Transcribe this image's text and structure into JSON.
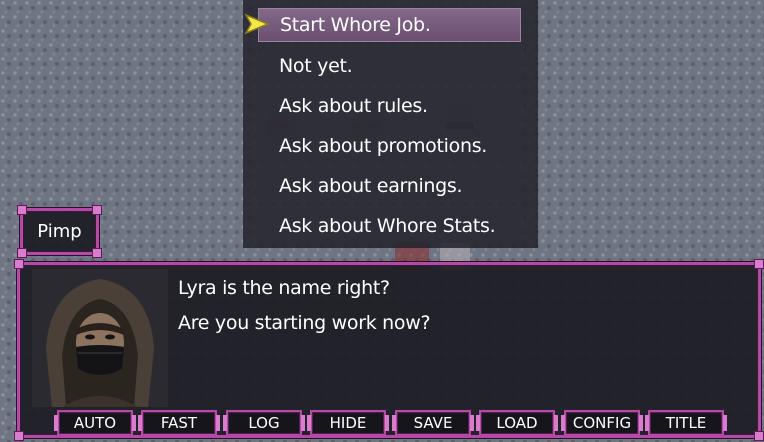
{
  "choices": [
    "Start Whore Job.",
    "Not yet.",
    "Ask about rules.",
    "Ask about promotions.",
    "Ask about earnings.",
    "Ask about Whore Stats."
  ],
  "selected_choice_index": 0,
  "speaker": "Pimp",
  "message": {
    "line1": "Lyra is the name right?",
    "line2": "Are you starting work now?"
  },
  "system_buttons": [
    "AUTO",
    "FAST",
    "LOG",
    "HIDE",
    "SAVE",
    "LOAD",
    "CONFIG",
    "TITLE"
  ],
  "colors": {
    "window_border": "#b44aa6",
    "selected_choice": "#7a5e80",
    "cursor_arrow": "#f2e64a"
  },
  "icons": {
    "cursor": "selection-arrow-icon",
    "portrait": "hooded-masked-man-portrait"
  }
}
